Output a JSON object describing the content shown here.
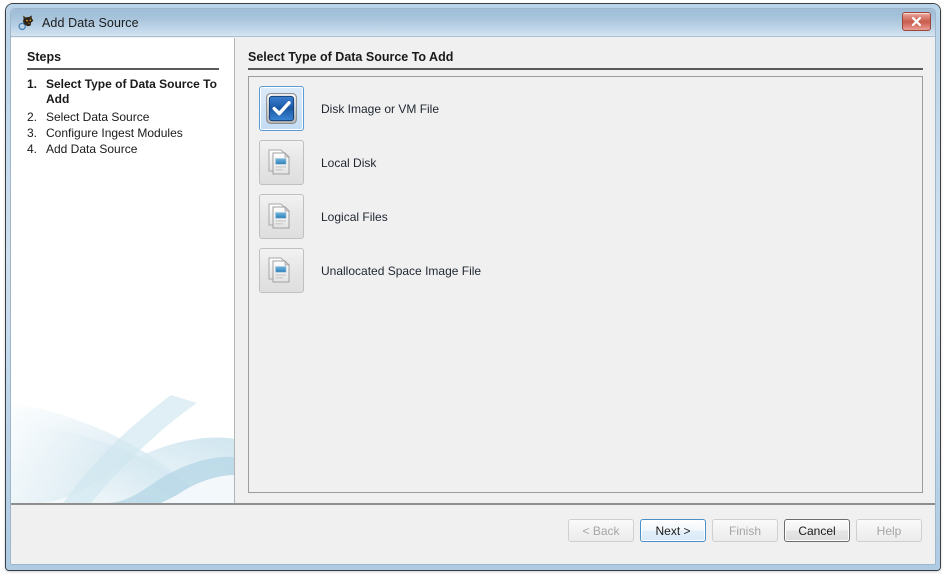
{
  "window": {
    "title": "Add Data Source",
    "icon": "autopsy-logo-icon",
    "close_label": "×"
  },
  "steps": {
    "heading": "Steps",
    "items": [
      {
        "num": "1.",
        "label": "Select Type of Data Source To Add",
        "current": true
      },
      {
        "num": "2.",
        "label": "Select Data Source",
        "current": false
      },
      {
        "num": "3.",
        "label": "Configure Ingest Modules",
        "current": false
      },
      {
        "num": "4.",
        "label": "Add Data Source",
        "current": false
      }
    ]
  },
  "content": {
    "heading": "Select Type of Data Source To Add",
    "options": [
      {
        "label": "Disk Image or VM File",
        "icon": "blue-checkbox-icon",
        "selected": true
      },
      {
        "label": "Local Disk",
        "icon": "stacked-pages-icon",
        "selected": false
      },
      {
        "label": "Logical Files",
        "icon": "stacked-pages-icon",
        "selected": false
      },
      {
        "label": "Unallocated Space Image File",
        "icon": "stacked-pages-icon",
        "selected": false
      }
    ]
  },
  "footer": {
    "buttons": [
      {
        "label": "< Back",
        "state": "disabled"
      },
      {
        "label": "Next >",
        "state": "focused"
      },
      {
        "label": "Finish",
        "state": "disabled"
      },
      {
        "label": "Cancel",
        "state": "default"
      },
      {
        "label": "Help",
        "state": "disabled"
      }
    ]
  },
  "colors": {
    "titlebar_top": "#9fbdd8",
    "titlebar_bottom": "#d5e4f1",
    "accent_blue": "#2f72b8",
    "close_red": "#c75c4c",
    "panel_bg": "#f0f0f0"
  }
}
